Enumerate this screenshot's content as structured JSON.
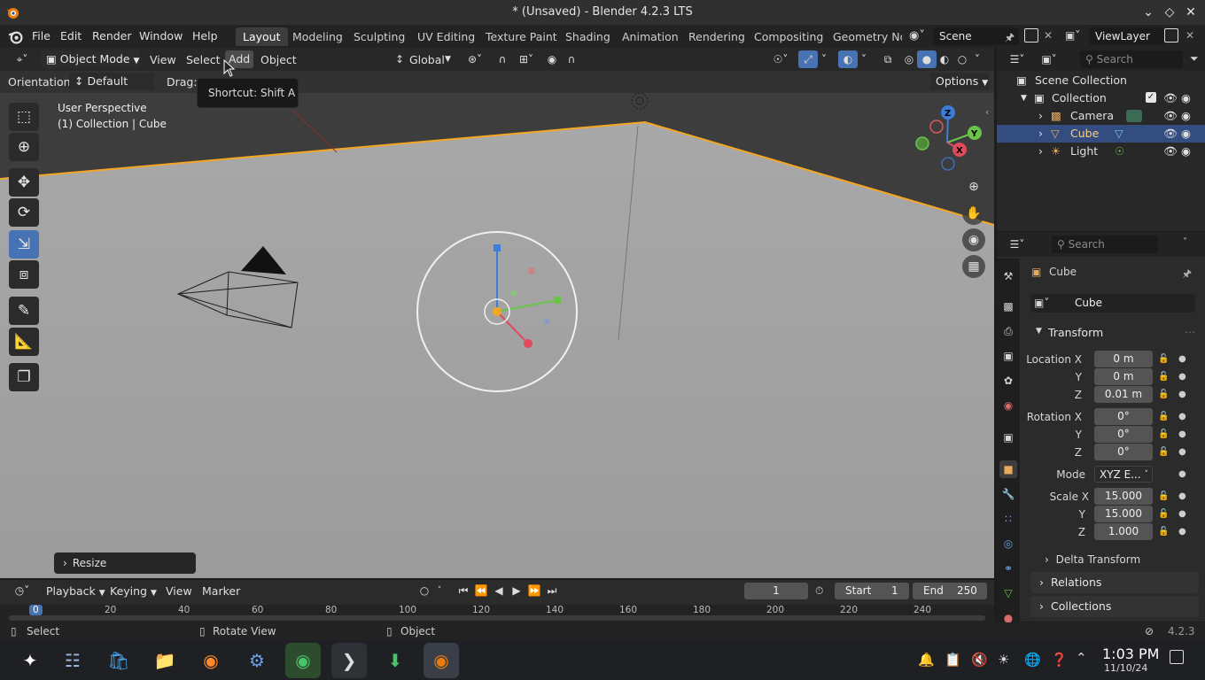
{
  "window": {
    "title": "* (Unsaved) - Blender 4.2.3 LTS"
  },
  "menu": {
    "file": "File",
    "edit": "Edit",
    "render": "Render",
    "window": "Window",
    "help": "Help"
  },
  "workspaces": [
    "Layout",
    "Modeling",
    "Sculpting",
    "UV Editing",
    "Texture Paint",
    "Shading",
    "Animation",
    "Rendering",
    "Compositing",
    "Geometry Noc"
  ],
  "scene": {
    "name": "Scene",
    "view_layer": "ViewLayer"
  },
  "viewport": {
    "mode": "Object Mode",
    "menus": {
      "view": "View",
      "select": "Select",
      "add": "Add",
      "object": "Object"
    },
    "transform_orientation": "Global",
    "tool_settings": {
      "orientation_label": "Orientation:",
      "orientation_value": "Default",
      "drag_label": "Drag:",
      "options": "Options"
    },
    "overlay_text": {
      "perspective": "User Perspective",
      "collection": "(1) Collection | Cube"
    },
    "tooltip": "Shortcut: Shift A",
    "operator_panel": "Resize",
    "gizmo": {
      "x": "X",
      "y": "Y",
      "z": "Z"
    }
  },
  "outliner": {
    "search_placeholder": "Search",
    "scene_collection": "Scene Collection",
    "collection": "Collection",
    "items": [
      {
        "name": "Camera",
        "selected": false
      },
      {
        "name": "Cube",
        "selected": true
      },
      {
        "name": "Light",
        "selected": false
      }
    ]
  },
  "properties": {
    "search_placeholder": "Search",
    "object_name": "Cube",
    "object_field": "Cube",
    "transform_header": "Transform",
    "location": {
      "label": "Location X",
      "x": "0 m",
      "y": "0 m",
      "z": "0.01 m"
    },
    "rotation": {
      "label": "Rotation X",
      "x": "0°",
      "y": "0°",
      "z": "0°"
    },
    "mode": {
      "label": "Mode",
      "value": "XYZ E..."
    },
    "scale": {
      "label": "Scale X",
      "x": "15.000",
      "y": "15.000",
      "z": "1.000"
    },
    "axis_labels": {
      "y": "Y",
      "z": "Z"
    },
    "delta_transform": "Delta Transform",
    "relations": "Relations",
    "collections": "Collections"
  },
  "timeline": {
    "playback": "Playback",
    "keying": "Keying",
    "view": "View",
    "marker": "Marker",
    "current_frame": "1",
    "start_label": "Start",
    "start": "1",
    "end_label": "End",
    "end": "250",
    "ruler": [
      "0",
      "20",
      "40",
      "60",
      "80",
      "100",
      "120",
      "140",
      "160",
      "180",
      "200",
      "220",
      "240"
    ]
  },
  "statusbar": {
    "select": "Select",
    "rotate": "Rotate View",
    "object": "Object",
    "version": "4.2.3"
  },
  "taskbar": {
    "time": "1:03 PM",
    "date": "11/10/24"
  },
  "colors": {
    "accent": "#4772b3",
    "selection_orange": "#f5a623",
    "selected_row": "#334d80"
  }
}
